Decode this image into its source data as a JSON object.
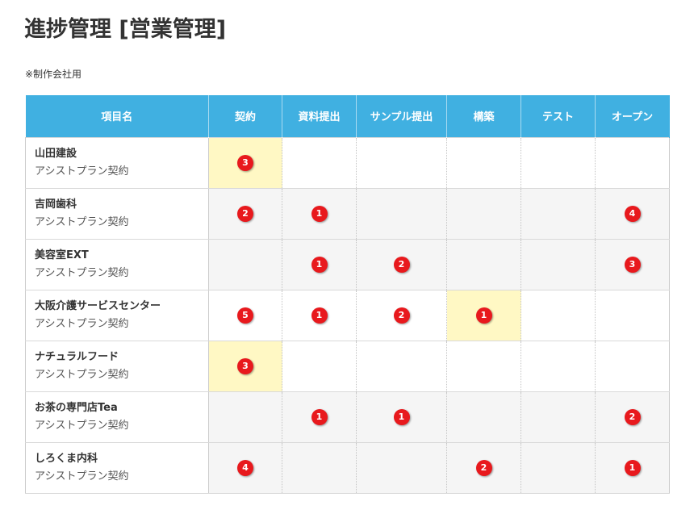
{
  "page": {
    "title": "進捗管理 [営業管理]",
    "note": "※制作会社用"
  },
  "colors": {
    "header_bg": "#40b0e1",
    "highlight_bg": "#fff8c4",
    "shaded_row_bg": "#f5f5f5",
    "badge_bg": "#e8191d",
    "text": "#333333"
  },
  "table": {
    "columns": [
      "項目名",
      "契約",
      "資料提出",
      "サンプル提出",
      "構築",
      "テスト",
      "オープン"
    ],
    "rows": [
      {
        "name": "山田建設",
        "plan": "アシストプラン契約",
        "shaded": false,
        "cells": [
          {
            "count": 3,
            "highlight": true
          },
          {
            "count": null
          },
          {
            "count": null
          },
          {
            "count": null
          },
          {
            "count": null
          },
          {
            "count": null
          }
        ]
      },
      {
        "name": "吉岡歯科",
        "plan": "アシストプラン契約",
        "shaded": true,
        "cells": [
          {
            "count": 2
          },
          {
            "count": 1
          },
          {
            "count": null
          },
          {
            "count": null
          },
          {
            "count": null
          },
          {
            "count": 4
          }
        ]
      },
      {
        "name": "美容室EXT",
        "plan": "アシストプラン契約",
        "shaded": true,
        "cells": [
          {
            "count": null
          },
          {
            "count": 1
          },
          {
            "count": 2
          },
          {
            "count": null
          },
          {
            "count": null
          },
          {
            "count": 3
          }
        ]
      },
      {
        "name": "大阪介護サービスセンター",
        "plan": "アシストプラン契約",
        "shaded": false,
        "cells": [
          {
            "count": 5
          },
          {
            "count": 1
          },
          {
            "count": 2
          },
          {
            "count": 1,
            "highlight": true
          },
          {
            "count": null
          },
          {
            "count": null
          }
        ]
      },
      {
        "name": "ナチュラルフード",
        "plan": "アシストプラン契約",
        "shaded": false,
        "cells": [
          {
            "count": 3,
            "highlight": true
          },
          {
            "count": null
          },
          {
            "count": null
          },
          {
            "count": null
          },
          {
            "count": null
          },
          {
            "count": null
          }
        ]
      },
      {
        "name": "お茶の専門店Tea",
        "plan": "アシストプラン契約",
        "shaded": true,
        "cells": [
          {
            "count": null
          },
          {
            "count": 1
          },
          {
            "count": 1
          },
          {
            "count": null
          },
          {
            "count": null
          },
          {
            "count": 2
          }
        ]
      },
      {
        "name": "しろくま内科",
        "plan": "アシストプラン契約",
        "shaded": true,
        "cells": [
          {
            "count": 4
          },
          {
            "count": null
          },
          {
            "count": null
          },
          {
            "count": 2
          },
          {
            "count": null
          },
          {
            "count": 1
          }
        ]
      }
    ]
  }
}
